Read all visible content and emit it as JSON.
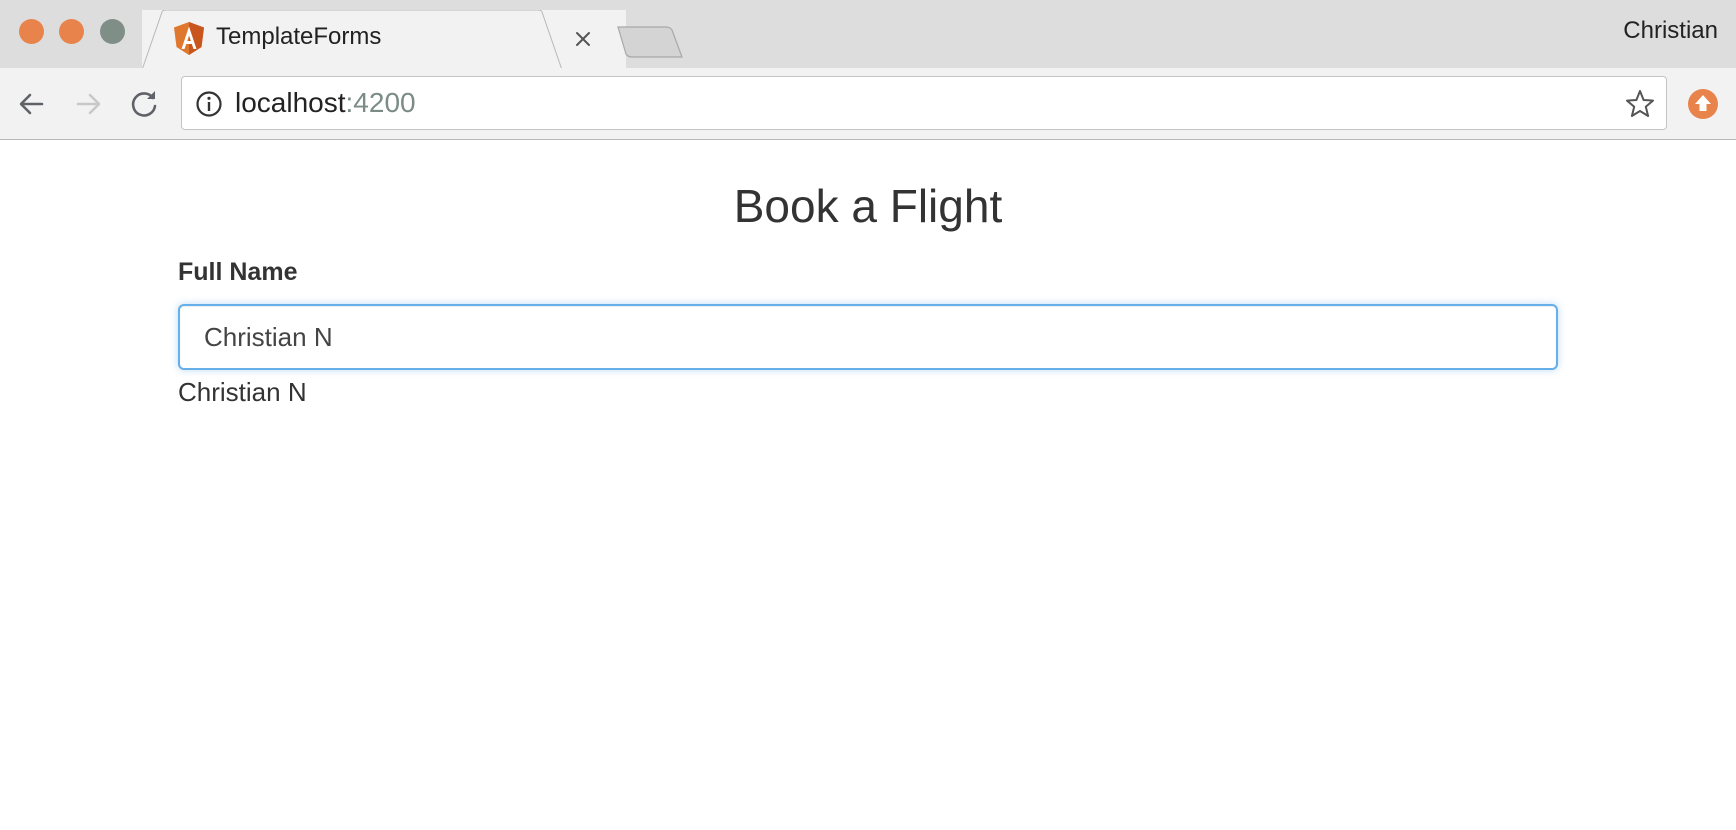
{
  "window": {
    "traffic_lights": {
      "close": "#e8834b",
      "minimize": "#e8834b",
      "maximize": "#7f8e87"
    },
    "profile_name": "Christian"
  },
  "tab": {
    "title": "TemplateForms",
    "favicon": "angular-icon",
    "favicon_color": "#e0772e"
  },
  "toolbar": {
    "url_host": "localhost",
    "url_port": ":4200",
    "icons": [
      "back-icon",
      "forward-icon",
      "reload-icon",
      "info-icon",
      "star-icon",
      "extension-update-icon"
    ],
    "extension_color": "#e8834b"
  },
  "page": {
    "title": "Book a Flight",
    "full_name_label": "Full Name",
    "full_name_value": "Christian N",
    "full_name_echo": "Christian N"
  }
}
